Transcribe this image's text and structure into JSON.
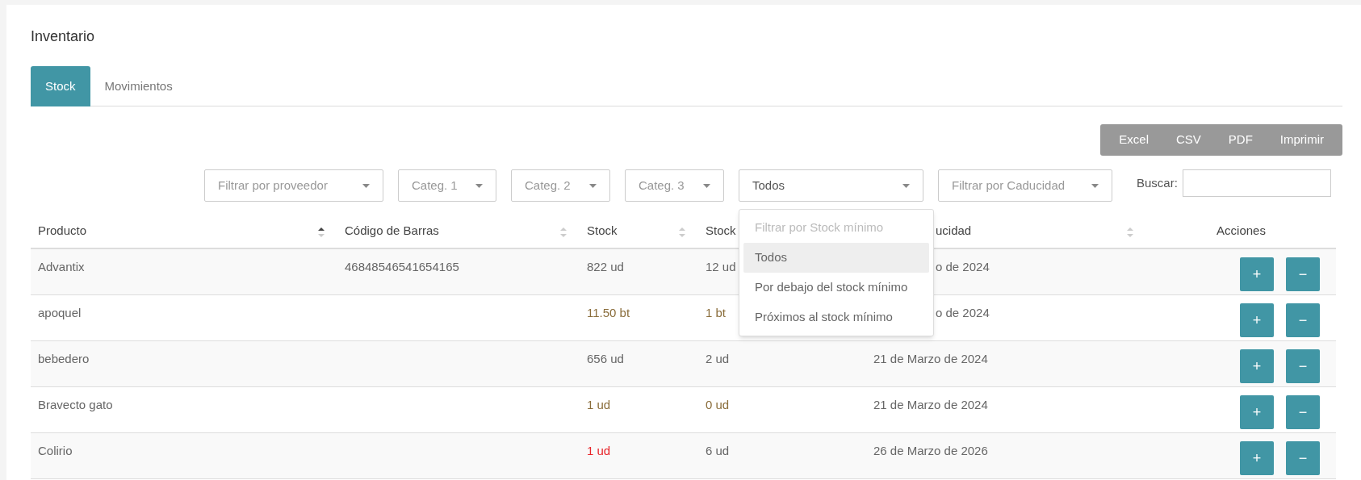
{
  "title": "Inventario",
  "tabs": [
    {
      "label": "Stock",
      "selected": true
    },
    {
      "label": "Movimientos",
      "selected": false
    }
  ],
  "export_buttons": [
    "Excel",
    "CSV",
    "PDF",
    "Imprimir"
  ],
  "filters": [
    {
      "kind": "select",
      "placeholder": "Filtrar por proveedor"
    },
    {
      "kind": "select",
      "placeholder": "Categ. 1"
    },
    {
      "kind": "select",
      "placeholder": "Categ. 2"
    },
    {
      "kind": "select",
      "placeholder": "Categ. 3"
    },
    {
      "kind": "select",
      "value": "Todos",
      "expanded": true,
      "options": [
        {
          "label": "Filtrar por Stock mínimo",
          "disabled": true,
          "selected": false
        },
        {
          "label": "Todos",
          "disabled": false,
          "selected": true
        },
        {
          "label": "Por debajo del stock mínimo",
          "disabled": false,
          "selected": false
        },
        {
          "label": "Próximos al stock mínimo",
          "disabled": false,
          "selected": false
        }
      ]
    },
    {
      "kind": "select",
      "placeholder": "Filtrar por Caducidad"
    }
  ],
  "search": {
    "label": "Buscar:"
  },
  "table": {
    "columns": [
      {
        "label": "Producto",
        "sortable": true,
        "sorted": true
      },
      {
        "label": "Código de Barras",
        "sortable": true,
        "sorted": false
      },
      {
        "label": "Stock",
        "sortable": true,
        "sorted": false
      },
      {
        "label": "Stock"
      },
      {
        "label": "ucidad",
        "clipped": true,
        "sortable": true,
        "sorted": false
      },
      {
        "label": "Acciones"
      }
    ],
    "rows": [
      {
        "cells": [
          {
            "text": "Advantix"
          },
          {
            "text": "46848546541654165"
          },
          {
            "text": "822 ud",
            "color": "#666666"
          },
          {
            "text": "12 ud",
            "color": "#666666"
          },
          {
            "text": "o de 2024",
            "clipped": true
          }
        ],
        "actions": [
          "+",
          "−"
        ]
      },
      {
        "cells": [
          {
            "text": "apoquel"
          },
          {
            "text": ""
          },
          {
            "text": "11.50 bt",
            "color": "#8a6d3b"
          },
          {
            "text": "1 bt",
            "color": "#8a6d3b"
          },
          {
            "text": "o de 2024",
            "clipped": true
          }
        ],
        "actions": [
          "+",
          "−"
        ]
      },
      {
        "cells": [
          {
            "text": "bebedero"
          },
          {
            "text": ""
          },
          {
            "text": "656 ud",
            "color": "#666666"
          },
          {
            "text": "2 ud",
            "color": "#666666"
          },
          {
            "text": "21 de Marzo de 2024"
          }
        ],
        "actions": [
          "+",
          "−"
        ]
      },
      {
        "cells": [
          {
            "text": "Bravecto gato"
          },
          {
            "text": ""
          },
          {
            "text": "1 ud",
            "color": "#8a6d3b"
          },
          {
            "text": "0 ud",
            "color": "#8a6d3b"
          },
          {
            "text": "21 de Marzo de 2024"
          }
        ],
        "actions": [
          "+",
          "−"
        ]
      },
      {
        "cells": [
          {
            "text": "Colirio"
          },
          {
            "text": ""
          },
          {
            "text": "1 ud",
            "color": "#e8262b"
          },
          {
            "text": "6 ud",
            "color": "#666666"
          },
          {
            "text": "26 de Marzo de 2026"
          }
        ],
        "actions": [
          "+",
          "−"
        ]
      }
    ]
  }
}
